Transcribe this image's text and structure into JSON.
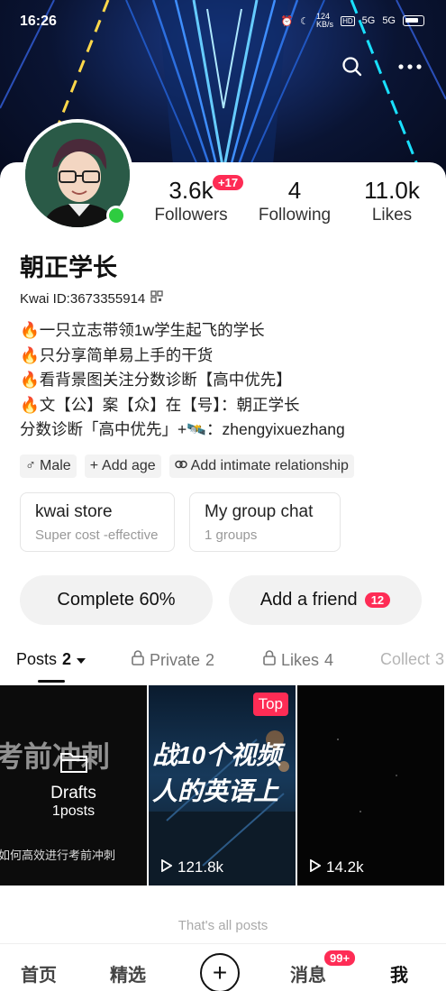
{
  "status_bar": {
    "time": "16:26",
    "speed": "124",
    "speed_unit": "KB/s",
    "net1": "5G",
    "net2": "5G"
  },
  "profile": {
    "name": "朝正学长",
    "kwai_id": "Kwai ID:3673355914",
    "bio": [
      "🔥一只立志带领1w学生起飞的学长",
      "🔥只分享简单易上手的干货",
      "🔥看背景图关注分数诊断【高中优先】",
      "🔥文【公】案【众】在【号】：朝正学长",
      "分数诊断「高中优先」+🛰️：zhengyixuezhang"
    ]
  },
  "stats": {
    "followers": {
      "value": "3.6k",
      "label": "Followers",
      "badge": "+17"
    },
    "following": {
      "value": "4",
      "label": "Following"
    },
    "likes": {
      "value": "11.0k",
      "label": "Likes"
    }
  },
  "tags": {
    "gender": "Male",
    "age": "Add age",
    "relationship": "Add intimate relationship"
  },
  "boxes": {
    "store": {
      "title": "kwai store",
      "subtitle": "Super cost -effective"
    },
    "group": {
      "title": "My group chat",
      "subtitle": "1 groups"
    }
  },
  "buttons": {
    "complete": "Complete 60%",
    "add_friend": "Add a friend",
    "add_friend_count": "12"
  },
  "tabs": {
    "posts": {
      "label": "Posts",
      "count": "2"
    },
    "private": {
      "label": "Private",
      "count": "2"
    },
    "likes": {
      "label": "Likes",
      "count": "4"
    },
    "collect": {
      "label": "Collect",
      "count": "3"
    }
  },
  "grid": {
    "cell1": {
      "bg_text": "考前冲刺",
      "drafts_label": "Drafts",
      "drafts_count": "1posts",
      "caption": "如何高效进行考前冲刺"
    },
    "cell2": {
      "line1": "战10个视频",
      "line2": "人的英语上",
      "badge": "Top",
      "views": "121.8k"
    },
    "cell3": {
      "views": "14.2k"
    }
  },
  "end_note": "That's all posts",
  "nav": {
    "home": "首页",
    "featured": "精选",
    "add": "+",
    "messages": "消息",
    "messages_badge": "99+",
    "me": "我"
  },
  "colors": {
    "accent": "#fe2c55",
    "online": "#2ecc40"
  }
}
